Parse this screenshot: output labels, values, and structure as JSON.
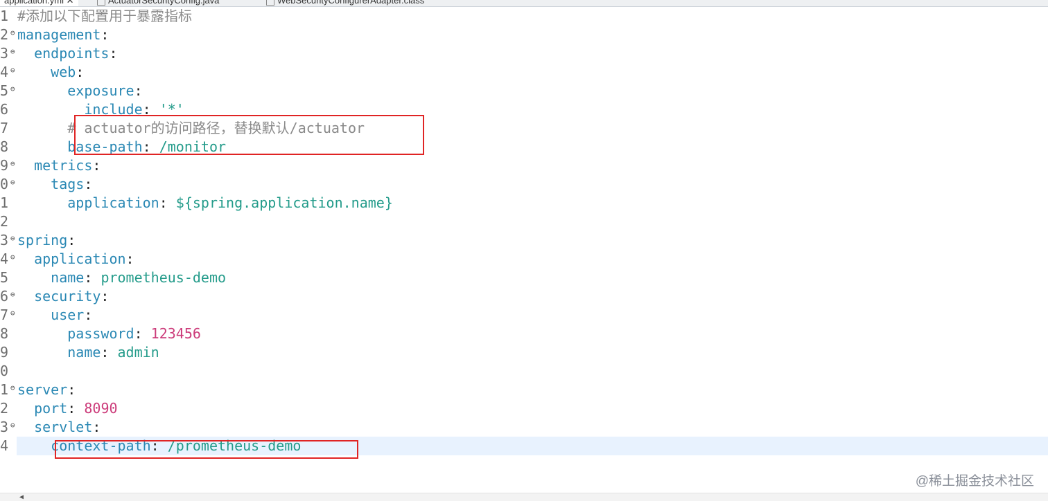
{
  "tabs": [
    {
      "label": "application.yml",
      "active": true
    },
    {
      "label": "ActuatorSecurityConfig.java",
      "active": false
    },
    {
      "label": "WebSecurityConfigurerAdapter.class",
      "active": false
    }
  ],
  "lines": [
    {
      "num": "1",
      "text": "#添加以下配置用于暴露指标"
    },
    {
      "num": "2",
      "text": "management:"
    },
    {
      "num": "3",
      "text": "  endpoints:"
    },
    {
      "num": "4",
      "text": "    web:"
    },
    {
      "num": "5",
      "text": "      exposure:"
    },
    {
      "num": "6",
      "text": "        include: '*'"
    },
    {
      "num": "7",
      "text": "      # actuator的访问路径，替换默认/actuator"
    },
    {
      "num": "8",
      "text": "      base-path: /monitor"
    },
    {
      "num": "9",
      "text": "  metrics:"
    },
    {
      "num": "0",
      "text": "    tags:"
    },
    {
      "num": "1",
      "text": "      application: ${spring.application.name}"
    },
    {
      "num": "2",
      "text": ""
    },
    {
      "num": "3",
      "text": "spring:"
    },
    {
      "num": "4",
      "text": "  application:"
    },
    {
      "num": "5",
      "text": "    name: prometheus-demo"
    },
    {
      "num": "6",
      "text": "  security:"
    },
    {
      "num": "7",
      "text": "    user:"
    },
    {
      "num": "8",
      "text": "      password: 123456"
    },
    {
      "num": "9",
      "text": "      name: admin"
    },
    {
      "num": "0",
      "text": ""
    },
    {
      "num": "1",
      "text": "server:"
    },
    {
      "num": "2",
      "text": "  port: 8090"
    },
    {
      "num": "3",
      "text": "  servlet:"
    },
    {
      "num": "4",
      "text": "    context-path: /prometheus-demo"
    }
  ],
  "watermark": "@稀土掘金技术社区",
  "colors": {
    "key": "#2a88b4",
    "string": "#239b8a",
    "number": "#cc3b7a",
    "comment": "#8a8a8a",
    "highlight_box": "#e02424",
    "current_line": "#e8f2fe"
  }
}
